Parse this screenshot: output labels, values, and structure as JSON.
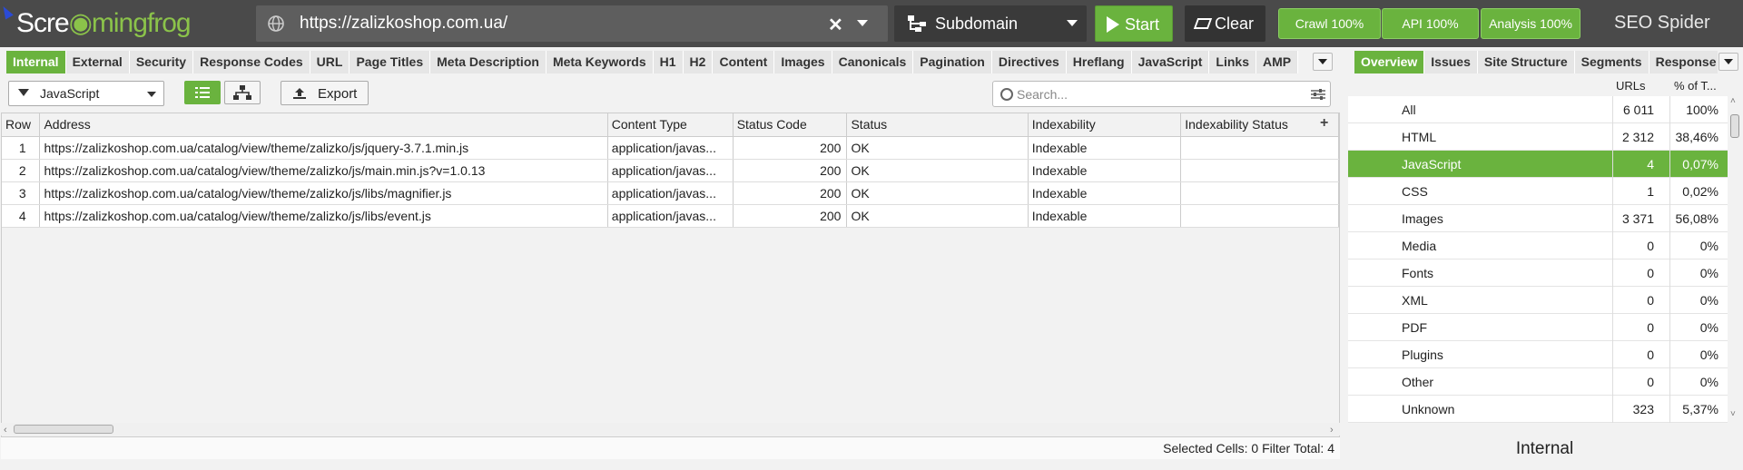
{
  "app": {
    "brand": "SEO Spider"
  },
  "logo": {
    "part1": "Scre",
    "part2": "mingfrog"
  },
  "topbar": {
    "url": "https://zalizkoshop.com.ua/",
    "mode": "Subdomain",
    "start_label": "Start",
    "clear_label": "Clear",
    "crawl_label": "Crawl 100%",
    "api_label": "API 100%",
    "analysis_label": "Analysis 100%",
    "accent_color": "#6ab33e"
  },
  "tabs_left": [
    "Internal",
    "External",
    "Security",
    "Response Codes",
    "URL",
    "Page Titles",
    "Meta Description",
    "Meta Keywords",
    "H1",
    "H2",
    "Content",
    "Images",
    "Canonicals",
    "Pagination",
    "Directives",
    "Hreflang",
    "JavaScript",
    "Links",
    "AMP"
  ],
  "tabs_right": [
    "Overview",
    "Issues",
    "Site Structure",
    "Segments",
    "Response Codes"
  ],
  "toolbar": {
    "filter": "JavaScript",
    "export_label": "Export",
    "search_placeholder": "Search..."
  },
  "table": {
    "columns": [
      "Row",
      "Address",
      "Content Type",
      "Status Code",
      "Status",
      "Indexability",
      "Indexability Status"
    ],
    "rows": [
      [
        "1",
        "https://zalizkoshop.com.ua/catalog/view/theme/zalizko/js/jquery-3.7.1.min.js",
        "application/javas...",
        "200",
        "OK",
        "Indexable",
        ""
      ],
      [
        "2",
        "https://zalizkoshop.com.ua/catalog/view/theme/zalizko/js/main.min.js?v=1.0.13",
        "application/javas...",
        "200",
        "OK",
        "Indexable",
        ""
      ],
      [
        "3",
        "https://zalizkoshop.com.ua/catalog/view/theme/zalizko/js/libs/magnifier.js",
        "application/javas...",
        "200",
        "OK",
        "Indexable",
        ""
      ],
      [
        "4",
        "https://zalizkoshop.com.ua/catalog/view/theme/zalizko/js/libs/event.js",
        "application/javas...",
        "200",
        "OK",
        "Indexable",
        ""
      ]
    ]
  },
  "statusbar": {
    "selected_label": "Selected Cells:",
    "selected_value": "0",
    "filter_label": "Filter Total:",
    "filter_value": "4"
  },
  "right_panel": {
    "col_urls": "URLs",
    "col_pct": "% of T...",
    "rows": [
      {
        "label": "All",
        "count": "6 011",
        "pct": "100%"
      },
      {
        "label": "HTML",
        "count": "2 312",
        "pct": "38,46%"
      },
      {
        "label": "JavaScript",
        "count": "4",
        "pct": "0,07%",
        "selected": true
      },
      {
        "label": "CSS",
        "count": "1",
        "pct": "0,02%"
      },
      {
        "label": "Images",
        "count": "3 371",
        "pct": "56,08%"
      },
      {
        "label": "Media",
        "count": "0",
        "pct": "0%"
      },
      {
        "label": "Fonts",
        "count": "0",
        "pct": "0%"
      },
      {
        "label": "XML",
        "count": "0",
        "pct": "0%"
      },
      {
        "label": "PDF",
        "count": "0",
        "pct": "0%"
      },
      {
        "label": "Plugins",
        "count": "0",
        "pct": "0%"
      },
      {
        "label": "Other",
        "count": "0",
        "pct": "0%"
      },
      {
        "label": "Unknown",
        "count": "323",
        "pct": "5,37%"
      }
    ],
    "footer": "Internal"
  }
}
